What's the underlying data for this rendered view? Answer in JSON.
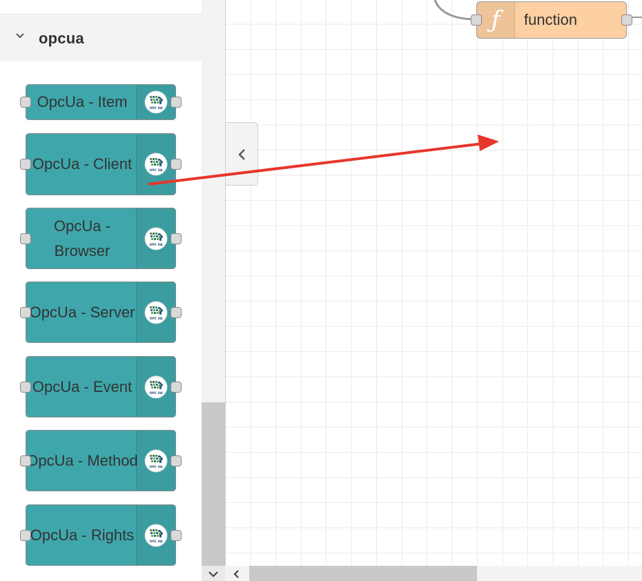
{
  "palette": {
    "category": {
      "title": "opcua",
      "icon": "chevron-down-icon"
    },
    "nodes": [
      {
        "label": "OpcUa - Item",
        "icon": "opcua-logo-icon",
        "color": "#3fa7ab"
      },
      {
        "label": "OpcUa - Client",
        "icon": "opcua-logo-icon",
        "color": "#3fa7ab"
      },
      {
        "label": "OpcUa - Browser",
        "icon": "opcua-logo-icon",
        "color": "#3fa7ab"
      },
      {
        "label": "OpcUa - Server",
        "icon": "opcua-logo-icon",
        "color": "#3fa7ab"
      },
      {
        "label": "OpcUa - Event",
        "icon": "opcua-logo-icon",
        "color": "#3fa7ab"
      },
      {
        "label": "OpcUa - Method",
        "icon": "opcua-logo-icon",
        "color": "#3fa7ab"
      },
      {
        "label": "OpcUa - Rights",
        "icon": "opcua-logo-icon",
        "color": "#3fa7ab"
      }
    ],
    "logo_text": "OPC UA"
  },
  "workspace": {
    "function_node": {
      "label": "function",
      "icon": "function-icon",
      "icon_glyph": "ƒ",
      "color": "#fdd0a2"
    },
    "annotation": {
      "type": "drag-arrow",
      "color": "#e8352b"
    }
  },
  "controls": {
    "collapse_icon": "chevron-left-icon",
    "palette_toggle_icon": "chevron-down-icon",
    "scroll_left_icon": "chevron-left-icon"
  }
}
